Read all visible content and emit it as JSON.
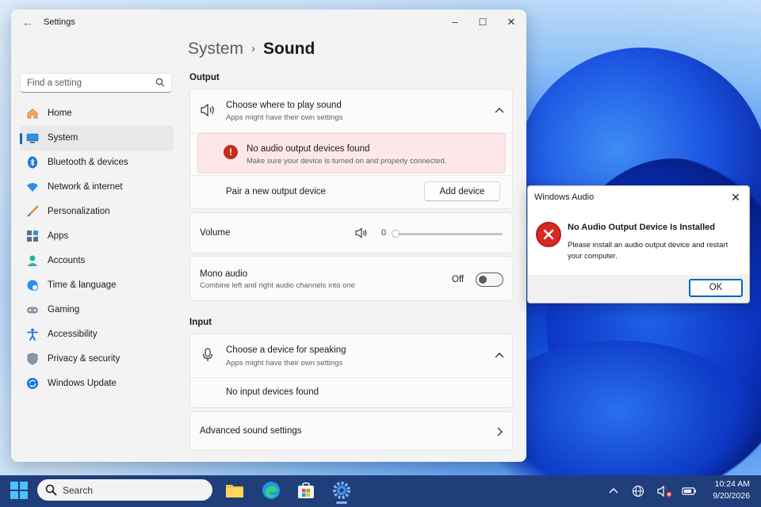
{
  "window": {
    "title": "Settings",
    "back_icon": "back-arrow-icon",
    "minimize": "–",
    "maximize": "☐",
    "close": "✕"
  },
  "search": {
    "placeholder": "Find a setting",
    "icon": "search-icon"
  },
  "sidebar": {
    "items": [
      {
        "label": "Home",
        "icon": "home-icon",
        "active": false
      },
      {
        "label": "System",
        "icon": "system-icon",
        "active": true
      },
      {
        "label": "Bluetooth & devices",
        "icon": "bluetooth-icon",
        "active": false
      },
      {
        "label": "Network & internet",
        "icon": "wifi-icon",
        "active": false
      },
      {
        "label": "Personalization",
        "icon": "brush-icon",
        "active": false
      },
      {
        "label": "Apps",
        "icon": "apps-icon",
        "active": false
      },
      {
        "label": "Accounts",
        "icon": "accounts-icon",
        "active": false
      },
      {
        "label": "Time & language",
        "icon": "globe-clock-icon",
        "active": false
      },
      {
        "label": "Gaming",
        "icon": "gamepad-icon",
        "active": false
      },
      {
        "label": "Accessibility",
        "icon": "accessibility-icon",
        "active": false
      },
      {
        "label": "Privacy & security",
        "icon": "shield-icon",
        "active": false
      },
      {
        "label": "Windows Update",
        "icon": "update-icon",
        "active": false
      }
    ]
  },
  "breadcrumb": {
    "parent": "System",
    "separator": "›",
    "current": "Sound"
  },
  "output": {
    "heading": "Output",
    "choose_title": "Choose where to play sound",
    "choose_sub": "Apps might have their own settings",
    "alert_title": "No audio output devices found",
    "alert_sub": "Make sure your device is turned on and properly connected.",
    "alert_icon_glyph": "!",
    "pair_label": "Pair a new output device",
    "add_device": "Add device"
  },
  "volume": {
    "label": "Volume",
    "value": "0",
    "level": 0
  },
  "mono": {
    "title": "Mono audio",
    "sub": "Combine left and right audio channels into one",
    "state": "Off"
  },
  "input": {
    "heading": "Input",
    "choose_title": "Choose a device for speaking",
    "choose_sub": "Apps might have their own settings",
    "none": "No input devices found"
  },
  "advanced": {
    "label": "Advanced sound settings"
  },
  "dialog": {
    "title": "Windows Audio",
    "heading": "No Audio Output Device Is Installed",
    "text": "Please install an audio output device and restart your computer.",
    "ok": "OK",
    "close": "✕"
  },
  "taskbar": {
    "search_label": "Search",
    "time": "10:24 AM",
    "date": "9/20/2026"
  },
  "colors": {
    "accent": "#0067c0",
    "error": "#c42b1c",
    "alert_bg": "#fde7e9",
    "taskbar": "#1f3e7a"
  }
}
